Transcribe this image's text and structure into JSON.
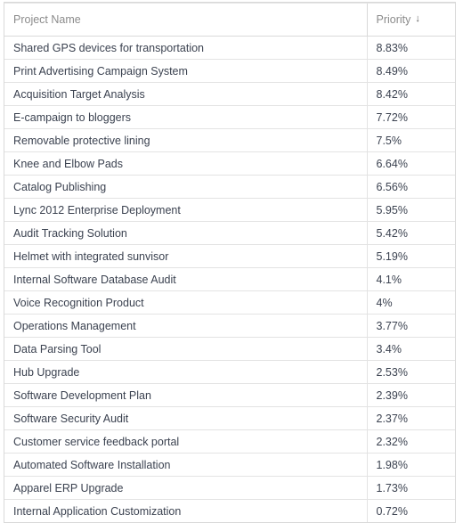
{
  "table": {
    "columns": [
      {
        "key": "name",
        "label": "Project Name",
        "sorted": false,
        "sort_icon": ""
      },
      {
        "key": "priority",
        "label": "Priority",
        "sorted": true,
        "sort_icon": "sort-descending-arrow-icon",
        "sort_glyph": "↓"
      }
    ],
    "rows": [
      {
        "name": "Shared GPS devices for transportation",
        "priority": "8.83%"
      },
      {
        "name": "Print Advertising Campaign System",
        "priority": "8.49%"
      },
      {
        "name": "Acquisition Target Analysis",
        "priority": "8.42%"
      },
      {
        "name": "E-campaign to bloggers",
        "priority": "7.72%"
      },
      {
        "name": "Removable protective lining",
        "priority": "7.5%"
      },
      {
        "name": "Knee and Elbow Pads",
        "priority": "6.64%"
      },
      {
        "name": "Catalog Publishing",
        "priority": "6.56%"
      },
      {
        "name": "Lync 2012 Enterprise Deployment",
        "priority": "5.95%"
      },
      {
        "name": "Audit Tracking Solution",
        "priority": "5.42%"
      },
      {
        "name": "Helmet with integrated sunvisor",
        "priority": "5.19%"
      },
      {
        "name": "Internal Software Database Audit",
        "priority": "4.1%"
      },
      {
        "name": "Voice Recognition Product",
        "priority": "4%"
      },
      {
        "name": "Operations Management",
        "priority": "3.77%"
      },
      {
        "name": "Data Parsing Tool",
        "priority": "3.4%"
      },
      {
        "name": "Hub Upgrade",
        "priority": "2.53%"
      },
      {
        "name": "Software Development Plan",
        "priority": "2.39%"
      },
      {
        "name": "Software Security Audit",
        "priority": "2.37%"
      },
      {
        "name": "Customer service feedback portal",
        "priority": "2.32%"
      },
      {
        "name": "Automated Software Installation",
        "priority": "1.98%"
      },
      {
        "name": "Apparel ERP Upgrade",
        "priority": "1.73%"
      },
      {
        "name": "Internal Application Customization",
        "priority": "0.72%"
      }
    ]
  },
  "colors": {
    "header_text": "#8b8b8b",
    "body_text": "#3b4250",
    "border": "#d9d9d9",
    "row_border": "#e3e3e3",
    "background": "#ffffff"
  }
}
